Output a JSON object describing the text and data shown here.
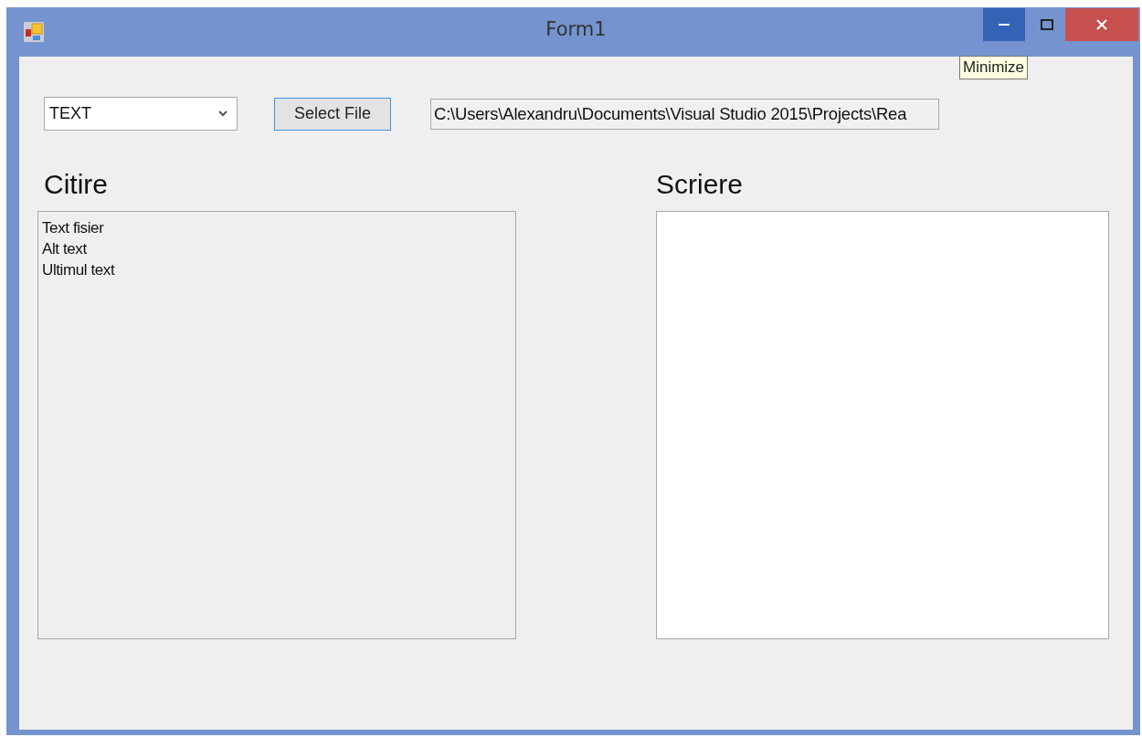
{
  "window": {
    "title": "Form1",
    "buttons": [
      {
        "kind": "minimize",
        "hovered": true
      },
      {
        "kind": "maximize",
        "hovered": false
      },
      {
        "kind": "close",
        "hovered": false
      }
    ],
    "tooltip": "Minimize"
  },
  "toolbar": {
    "format_combo": {
      "value": "TEXT"
    },
    "select_button": "Select File",
    "path_field": {
      "value": "C:\\Users\\Alexandru\\Documents\\Visual Studio 2015\\Projects\\Rea"
    }
  },
  "panels": [
    {
      "heading": "Citire",
      "read_only": true,
      "lines": [
        "Text fisier",
        "Alt text",
        "Ultimul text"
      ]
    },
    {
      "heading": "Scriere",
      "read_only": false
    }
  ]
}
